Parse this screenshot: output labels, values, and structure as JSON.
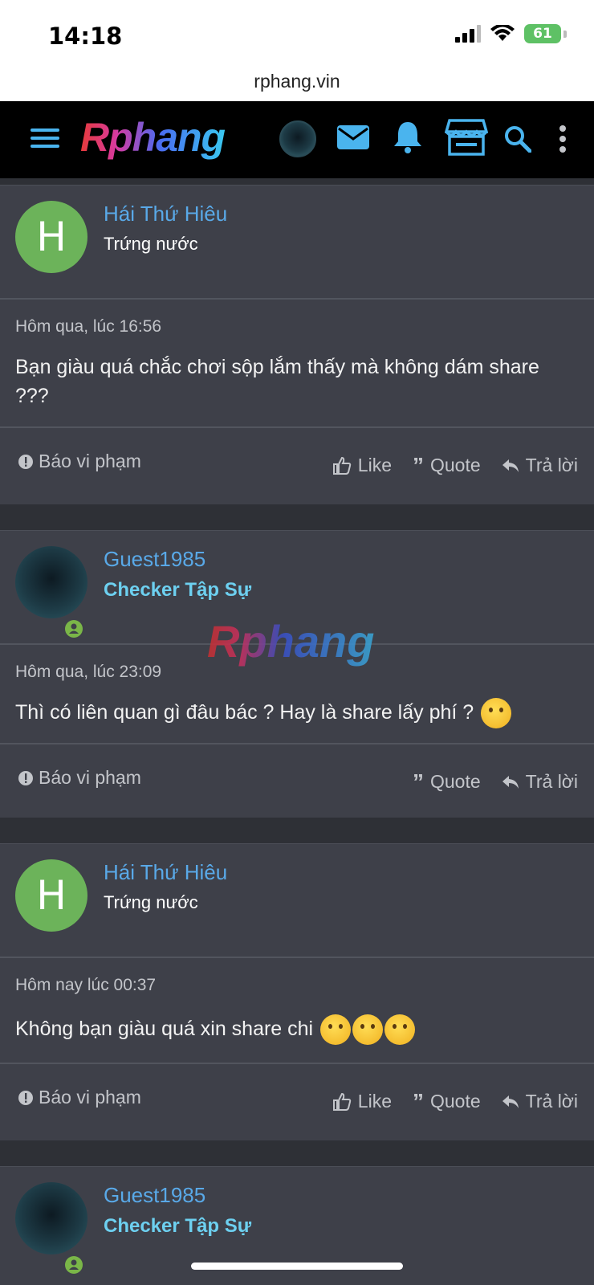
{
  "status": {
    "time": "14:18",
    "battery": "61"
  },
  "browser": {
    "url": "rphang.vin"
  },
  "nav": {
    "logo": "Rphang"
  },
  "watermark": "Rphang",
  "posts": [
    {
      "username": "Hái Thứ Hiêu",
      "user_title": "Trứng nước",
      "avatar_letter": "H",
      "time": "Hôm qua, lúc 16:56",
      "text": "Bạn giàu quá chắc chơi sộp lắm thấy mà không dám share ???",
      "report": "Báo vi phạm",
      "like": "Like",
      "quote": "Quote",
      "reply": "Trả lời"
    },
    {
      "username": "Guest1985",
      "user_title": "Checker Tập Sự",
      "time": "Hôm qua, lúc 23:09",
      "text": "Thì có liên quan gì đâu bác ? Hay là share lấy phí ?",
      "report": "Báo vi phạm",
      "quote": "Quote",
      "reply": "Trả lời"
    },
    {
      "username": "Hái Thứ Hiêu",
      "user_title": "Trứng nước",
      "avatar_letter": "H",
      "time": "Hôm nay lúc 00:37",
      "text": "Không bạn giàu quá xin share chi",
      "report": "Báo vi phạm",
      "like": "Like",
      "quote": "Quote",
      "reply": "Trả lời"
    },
    {
      "username": "Guest1985",
      "user_title": "Checker Tập Sự"
    }
  ],
  "colors": {
    "accent": "#59a9e8",
    "checker": "#6dd0f0",
    "card": "#3e4049",
    "page": "#2e3036"
  }
}
